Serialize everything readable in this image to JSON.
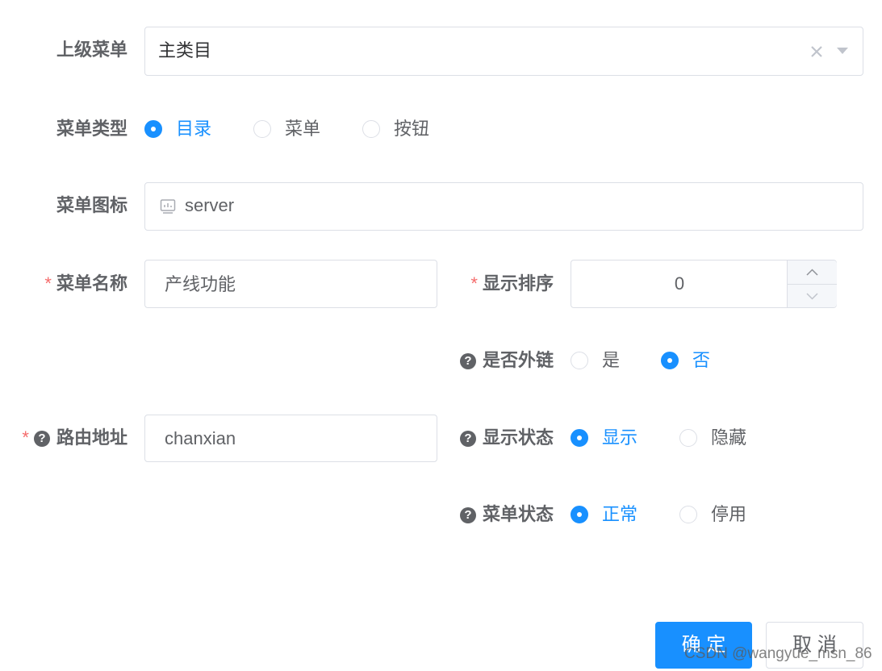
{
  "form": {
    "parent_menu": {
      "label": "上级菜单",
      "value": "主类目",
      "clear_icon": "close-icon",
      "arrow_icon": "caret-down-icon"
    },
    "menu_type": {
      "label": "菜单类型",
      "options": [
        "目录",
        "菜单",
        "按钮"
      ],
      "selected": "目录"
    },
    "menu_icon": {
      "label": "菜单图标",
      "value": "server",
      "icon": "monitor-icon"
    },
    "menu_name": {
      "required_mark": "*",
      "label": "菜单名称",
      "value": "产线功能"
    },
    "display_order": {
      "required_mark": "*",
      "label": "显示排序",
      "value": "0"
    },
    "external_link": {
      "help_icon": "?",
      "label": "是否外链",
      "options": [
        "是",
        "否"
      ],
      "selected": "否"
    },
    "route_path": {
      "required_mark": "*",
      "help_icon": "?",
      "label": "路由地址",
      "value": "chanxian"
    },
    "display_status": {
      "help_icon": "?",
      "label": "显示状态",
      "options": [
        "显示",
        "隐藏"
      ],
      "selected": "显示"
    },
    "menu_status": {
      "help_icon": "?",
      "label": "菜单状态",
      "options": [
        "正常",
        "停用"
      ],
      "selected": "正常"
    }
  },
  "footer": {
    "confirm_label": "确 定",
    "cancel_label": "取 消"
  },
  "watermark": "CSDN @wangyue_msn_86",
  "colors": {
    "primary": "#1890ff",
    "required": "#f56c6c",
    "border": "#dcdfe6",
    "text": "#606266"
  }
}
